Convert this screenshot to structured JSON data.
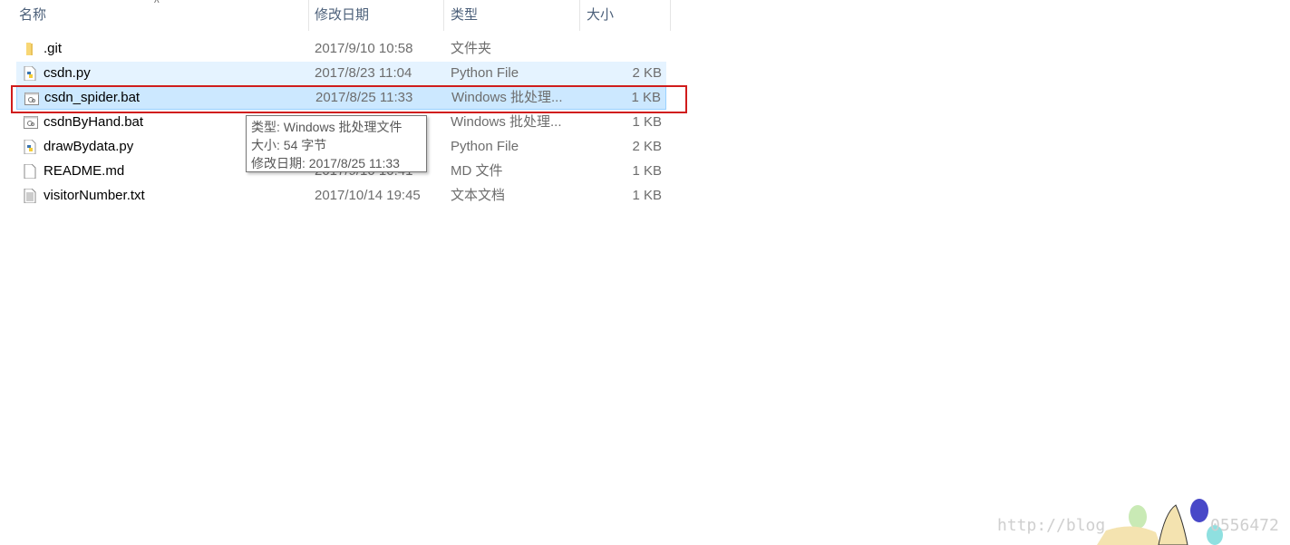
{
  "columns": {
    "name": "名称",
    "date": "修改日期",
    "type": "类型",
    "size": "大小"
  },
  "files": [
    {
      "name": ".git",
      "date": "2017/9/10 10:58",
      "type": "文件夹",
      "size": "",
      "icon": "folder-icon"
    },
    {
      "name": "csdn.py",
      "date": "2017/8/23 11:04",
      "type": "Python File",
      "size": "2 KB",
      "icon": "python-file-icon",
      "state": "hover"
    },
    {
      "name": "csdn_spider.bat",
      "date": "2017/8/25 11:33",
      "type": "Windows 批处理...",
      "size": "1 KB",
      "icon": "batch-file-icon",
      "state": "selected"
    },
    {
      "name": "csdnByHand.bat",
      "date": "",
      "type": "Windows 批处理...",
      "size": "1 KB",
      "icon": "batch-file-icon"
    },
    {
      "name": "drawBydata.py",
      "date": "",
      "type": "Python File",
      "size": "2 KB",
      "icon": "python-file-icon"
    },
    {
      "name": "README.md",
      "date": "2017/9/10 10:41",
      "type": "MD 文件",
      "size": "1 KB",
      "icon": "file-icon"
    },
    {
      "name": "visitorNumber.txt",
      "date": "2017/10/14 19:45",
      "type": "文本文档",
      "size": "1 KB",
      "icon": "text-file-icon"
    }
  ],
  "tooltip": {
    "line1": "类型: Windows 批处理文件",
    "line2": "大小: 54 字节",
    "line3": "修改日期: 2017/8/25 11:33"
  },
  "watermark": {
    "left": "http://blog",
    "right": "0556472"
  },
  "colors": {
    "hover": "#e5f3ff",
    "selected": "#cce8ff",
    "highlight_box": "#d01c1c"
  }
}
